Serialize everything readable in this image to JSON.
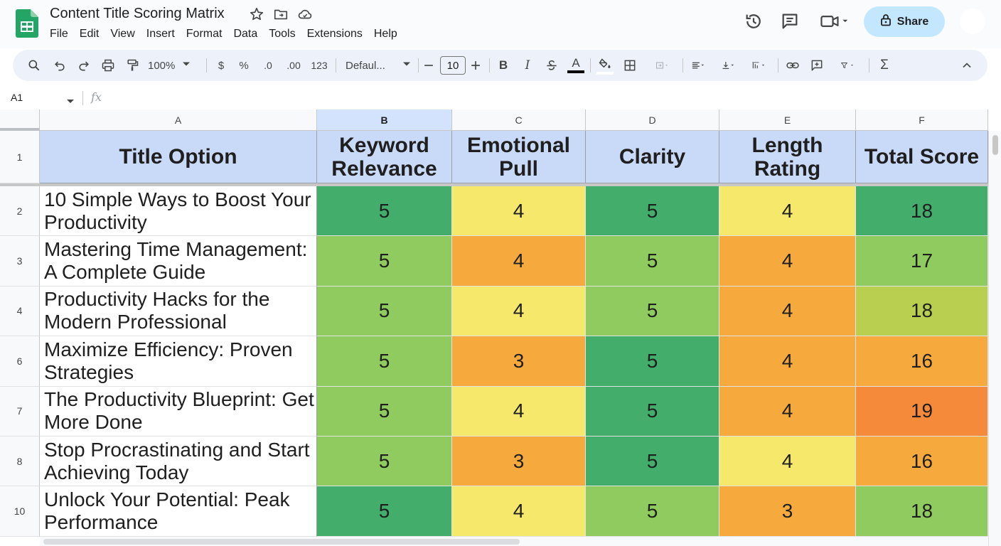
{
  "app": {
    "doc_title": "Content Title Scoring Matrix",
    "menu": [
      "File",
      "Edit",
      "View",
      "Insert",
      "Format",
      "Data",
      "Tools",
      "Extensions",
      "Help"
    ],
    "share_label": "Share",
    "icons": {
      "title": [
        "star-icon",
        "move-to-folder-icon",
        "cloud-saved-icon"
      ],
      "right": [
        "version-history-icon",
        "comments-icon",
        "meet-video-icon"
      ]
    }
  },
  "toolbar": {
    "zoom": "100%",
    "currency": "$",
    "percent": "%",
    "dec_decrease": ".0",
    "dec_increase": ".00",
    "number_format": "123",
    "font": "Defaul...",
    "font_size": "10",
    "bold": "B",
    "italic": "I",
    "text_color_glyph": "A",
    "sum_glyph": "Σ"
  },
  "formula_bar": {
    "name_box": "A1",
    "fx": "fx",
    "value": ""
  },
  "sheet": {
    "columns": [
      "A",
      "B",
      "C",
      "D",
      "E",
      "F"
    ],
    "selected_column": "B",
    "header_row_number": "1",
    "headers": [
      "Title Option",
      "Keyword Relevance",
      "Emotional Pull",
      "Clarity",
      "Length Rating",
      "Total Score"
    ],
    "rows": [
      {
        "num": "2",
        "title": "10 Simple Ways to Boost Your Productivity",
        "values": [
          "5",
          "4",
          "5",
          "4",
          "18"
        ],
        "colors": [
          "#43ad6b",
          "#f6e86b",
          "#43ad6b",
          "#f6e86b",
          "#43ad6b"
        ]
      },
      {
        "num": "3",
        "title": "Mastering Time Management: A Complete Guide",
        "values": [
          "5",
          "4",
          "5",
          "4",
          "17"
        ],
        "colors": [
          "#8fcb5e",
          "#f6a93c",
          "#8fcb5e",
          "#f6a93c",
          "#8fcb5e"
        ]
      },
      {
        "num": "4",
        "title": "Productivity Hacks for the Modern Professional",
        "values": [
          "5",
          "4",
          "5",
          "4",
          "18"
        ],
        "colors": [
          "#8fcb5e",
          "#f6e86b",
          "#8fcb5e",
          "#f6a93c",
          "#b8cf4f"
        ]
      },
      {
        "num": "6",
        "title": "Maximize Efficiency: Proven Strategies",
        "values": [
          "5",
          "3",
          "5",
          "4",
          "16"
        ],
        "colors": [
          "#8fcb5e",
          "#f6a93c",
          "#43ad6b",
          "#f6a93c",
          "#f6a93c"
        ]
      },
      {
        "num": "7",
        "title": "The Productivity Blueprint: Get More Done",
        "values": [
          "5",
          "4",
          "5",
          "4",
          "19"
        ],
        "colors": [
          "#8fcb5e",
          "#f6e86b",
          "#43ad6b",
          "#f6a93c",
          "#f58a3a"
        ]
      },
      {
        "num": "8",
        "title": "Stop Procrastinating and Start Achieving Today",
        "values": [
          "5",
          "3",
          "5",
          "4",
          "16"
        ],
        "colors": [
          "#8fcb5e",
          "#f6a93c",
          "#43ad6b",
          "#f6e86b",
          "#f6a93c"
        ]
      },
      {
        "num": "10",
        "title": "Unlock Your Potential: Peak Performance",
        "values": [
          "5",
          "4",
          "5",
          "3",
          "18"
        ],
        "colors": [
          "#43ad6b",
          "#f6e86b",
          "#8fcb5e",
          "#f6a93c",
          "#8fcb5e"
        ]
      }
    ]
  },
  "colors": {
    "header_fill": "#c9daf8",
    "share_fill": "#c2e7ff",
    "toolbar_fill": "#edf2fa",
    "logo_green": "#23a566"
  }
}
